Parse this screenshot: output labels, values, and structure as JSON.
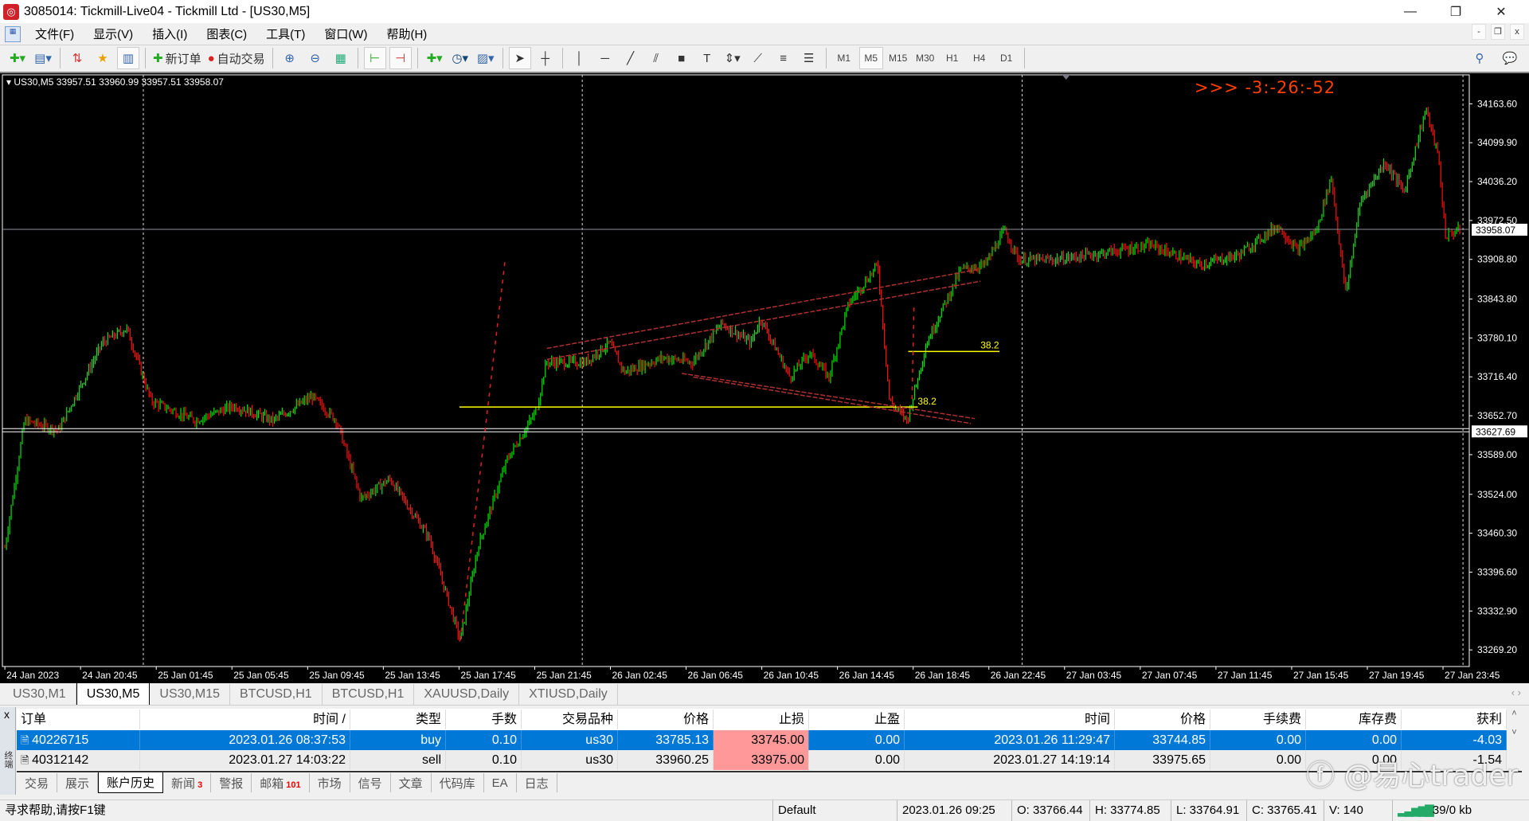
{
  "window": {
    "title": "3085014: Tickmill-Live04 - Tickmill Ltd - [US30,M5]",
    "minimize": "—",
    "restore": "❐",
    "close": "✕"
  },
  "menu": [
    "文件(F)",
    "显示(V)",
    "插入(I)",
    "图表(C)",
    "工具(T)",
    "窗口(W)",
    "帮助(H)"
  ],
  "toolbar": {
    "new_order": "新订单",
    "auto_trading": "自动交易",
    "timeframes": [
      "M1",
      "M5",
      "M15",
      "M30",
      "H1",
      "H4",
      "D1"
    ],
    "active_timeframe": "M5"
  },
  "chart": {
    "symbol_info": "US30,M5  33957.51 33960.99 33957.51 33958.07",
    "countdown": ">>> -3:-26:-52",
    "fib_label_1": "38.2",
    "fib_label_2": "38.2",
    "bid_label": "33958.07",
    "line_label": "33627.69"
  },
  "chart_data": {
    "type": "candlestick",
    "symbol": "US30",
    "timeframe": "M5",
    "ohlc_current": {
      "open": 33957.51,
      "high": 33960.99,
      "low": 33957.51,
      "close": 33958.07
    },
    "ylim": [
      33242,
      34211
    ],
    "xlim_hours": [
      -0.13,
      77.0
    ],
    "y_ticks": [
      "34163.60",
      "34099.90",
      "34036.20",
      "33972.50",
      "33908.80",
      "33843.80",
      "33780.10",
      "33716.40",
      "33652.70",
      "33589.00",
      "33524.00",
      "33460.30",
      "33396.60",
      "33332.90",
      "33269.20"
    ],
    "x_ticks": [
      "24 Jan 2023",
      "24 Jan 20:45",
      "25 Jan 01:45",
      "25 Jan 05:45",
      "25 Jan 09:45",
      "25 Jan 13:45",
      "25 Jan 17:45",
      "25 Jan 21:45",
      "26 Jan 02:45",
      "26 Jan 06:45",
      "26 Jan 10:45",
      "26 Jan 14:45",
      "26 Jan 18:45",
      "26 Jan 22:45",
      "27 Jan 03:45",
      "27 Jan 07:45",
      "27 Jan 11:45",
      "27 Jan 15:45",
      "27 Jan 19:45",
      "27 Jan 23:45"
    ],
    "price_path_hours": [
      [
        0,
        33437
      ],
      [
        1.03,
        33645
      ],
      [
        2.82,
        33629
      ],
      [
        5.13,
        33772
      ],
      [
        6.41,
        33796
      ],
      [
        7.69,
        33677
      ],
      [
        10,
        33645
      ],
      [
        12.05,
        33669
      ],
      [
        14.1,
        33645
      ],
      [
        16.15,
        33684
      ],
      [
        17.44,
        33645
      ],
      [
        18.72,
        33517
      ],
      [
        20.26,
        33549
      ],
      [
        22.31,
        33453
      ],
      [
        23.95,
        33285
      ],
      [
        24.87,
        33437
      ],
      [
        26.41,
        33581
      ],
      [
        27.95,
        33661
      ],
      [
        28.46,
        33740
      ],
      [
        30.51,
        33740
      ],
      [
        31.79,
        33772
      ],
      [
        32.56,
        33724
      ],
      [
        34.62,
        33748
      ],
      [
        36.15,
        33740
      ],
      [
        37.69,
        33804
      ],
      [
        39.23,
        33772
      ],
      [
        39.74,
        33812
      ],
      [
        41.28,
        33716
      ],
      [
        42.31,
        33756
      ],
      [
        43.33,
        33716
      ],
      [
        44.36,
        33836
      ],
      [
        45.9,
        33900
      ],
      [
        46.51,
        33677
      ],
      [
        47.44,
        33645
      ],
      [
        48.46,
        33772
      ],
      [
        50.26,
        33892
      ],
      [
        51.54,
        33900
      ],
      [
        52.56,
        33956
      ],
      [
        53.33,
        33908
      ],
      [
        55.13,
        33908
      ],
      [
        57.69,
        33919
      ],
      [
        60.26,
        33932
      ],
      [
        62.82,
        33900
      ],
      [
        64.87,
        33916
      ],
      [
        66.92,
        33964
      ],
      [
        67.95,
        33924
      ],
      [
        68.97,
        33956
      ],
      [
        69.74,
        34044
      ],
      [
        70.51,
        33852
      ],
      [
        71.28,
        34004
      ],
      [
        72.56,
        34068
      ],
      [
        73.59,
        34020
      ],
      [
        74.72,
        34156
      ],
      [
        75.38,
        34076
      ],
      [
        75.74,
        33948
      ],
      [
        76.56,
        33958
      ]
    ],
    "horizontal_lines": [
      {
        "price": 33958.07,
        "color": "#8a8f9a"
      },
      {
        "price": 33627.69,
        "color": "#ffffff"
      },
      {
        "price": 33667,
        "color": "#ffff00"
      }
    ],
    "colors": {
      "up": "#00e600",
      "down": "#ff1010",
      "background": "#000000"
    }
  },
  "chart_tabs": [
    "US30,M1",
    "US30,M5",
    "US30,M15",
    "BTCUSD,H1",
    "BTCUSD,H1",
    "XAUUSD,Daily",
    "XTIUSD,Daily"
  ],
  "terminal": {
    "close": "x",
    "side_label": "终端",
    "headers": [
      "订单",
      "时间 /",
      "类型",
      "手数",
      "交易品种",
      "价格",
      "止损",
      "止盈",
      "时间",
      "价格",
      "手续费",
      "库存费",
      "获利"
    ],
    "rows": [
      [
        "40226715",
        "2023.01.26 08:37:53",
        "buy",
        "0.10",
        "us30",
        "33785.13",
        "33745.00",
        "0.00",
        "2023.01.26 11:29:47",
        "33744.85",
        "0.00",
        "0.00",
        "-4.03"
      ],
      [
        "40312142",
        "2023.01.27 14:03:22",
        "sell",
        "0.10",
        "us30",
        "33960.25",
        "33975.00",
        "0.00",
        "2023.01.27 14:19:14",
        "33975.65",
        "0.00",
        "0.00",
        "-1.54"
      ]
    ],
    "tabs": [
      {
        "label": "交易"
      },
      {
        "label": "展示"
      },
      {
        "label": "账户历史",
        "active": true
      },
      {
        "label": "新闻",
        "badge": "3"
      },
      {
        "label": "警报"
      },
      {
        "label": "邮箱",
        "badge": "101"
      },
      {
        "label": "市场"
      },
      {
        "label": "信号"
      },
      {
        "label": "文章"
      },
      {
        "label": "代码库"
      },
      {
        "label": "EA"
      },
      {
        "label": "日志"
      }
    ]
  },
  "status": {
    "help": "寻求帮助,请按F1键",
    "profile": "Default",
    "datetime": "2023.01.26 09:25",
    "open": "O: 33766.44",
    "high": "H: 33774.85",
    "low": "L: 33764.91",
    "close": "C: 33765.41",
    "volume": "V: 140",
    "traffic": "39/0 kb"
  },
  "watermark": "ⓕ @易心trader"
}
